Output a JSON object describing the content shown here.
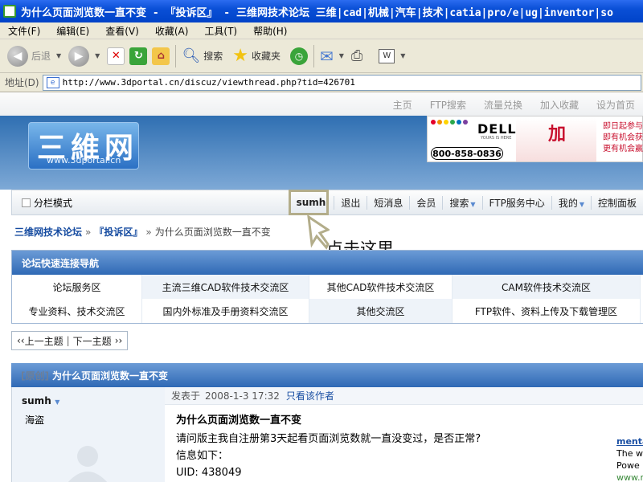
{
  "window": {
    "title": "为什么页面浏览数一直不变 - 『投诉区』 - 三维网技术论坛 三维|cad|机械|汽车|技术|catia|pro/e|ug|inventor|so"
  },
  "menubar": [
    "文件(F)",
    "编辑(E)",
    "查看(V)",
    "收藏(A)",
    "工具(T)",
    "帮助(H)"
  ],
  "toolbar": {
    "back": "后退",
    "search": "搜索",
    "favorites": "收藏夹"
  },
  "address": {
    "label": "地址(D)",
    "url": "http://www.3dportal.cn/discuz/viewthread.php?tid=426701"
  },
  "toplinks": [
    "主页",
    "FTP搜索",
    "流量兑换",
    "加入收藏",
    "设为首页"
  ],
  "logo": {
    "text": "三維网",
    "url": "www.3dportal.cn"
  },
  "banner": {
    "brand": "DELL",
    "tagline": "YOURS IS HERE",
    "phone": "800-858-0836",
    "big_char": "加",
    "lines": [
      "即日起参与",
      "即有机会获得",
      "更有机会赢取"
    ]
  },
  "navbar": {
    "split_mode": "分栏模式",
    "username": "sumh",
    "items": [
      "退出",
      "短消息",
      "会员",
      "搜索",
      "FTP服务中心",
      "我的",
      "控制面板"
    ]
  },
  "annotation": "点击这里",
  "breadcrumb": {
    "home": "三维网技术论坛",
    "forum": "『投诉区』",
    "current": "为什么页面浏览数一直不变"
  },
  "quicknav": {
    "title": "论坛快速连接导航",
    "row1": [
      "论坛服务区",
      "主流三维CAD软件技术交流区",
      "其他CAD软件技术交流区",
      "CAM软件技术交流区"
    ],
    "row2": [
      "专业资料、技术交流区",
      "国内外标准及手册资料交流区",
      "其他交流区",
      "FTP软件、资料上传及下载管理区"
    ]
  },
  "pager": {
    "prev": "上一主题",
    "next": "下一主题"
  },
  "thread": {
    "tag": "[原创]",
    "title": "为什么页面浏览数一直不变"
  },
  "post": {
    "author": "sumh",
    "rank": "海盗",
    "posted_label": "发表于",
    "posted_time": "2008-1-3 17:32",
    "only_author": "只看该作者",
    "title": "为什么页面浏览数一直不变",
    "body_line1": "请问版主我自注册第3天起看页面浏览数就一直没变过，是否正常?",
    "body_line2": "信息如下：",
    "body_line3": "UID: 438049"
  },
  "side_ad": {
    "link": "menta",
    "line1": "The w",
    "line2": "Powe",
    "url": "www.m"
  },
  "colors": {
    "title_bar": "#0a4fd6",
    "header_blue": "#2f69b5",
    "link_blue": "#154ba0"
  }
}
